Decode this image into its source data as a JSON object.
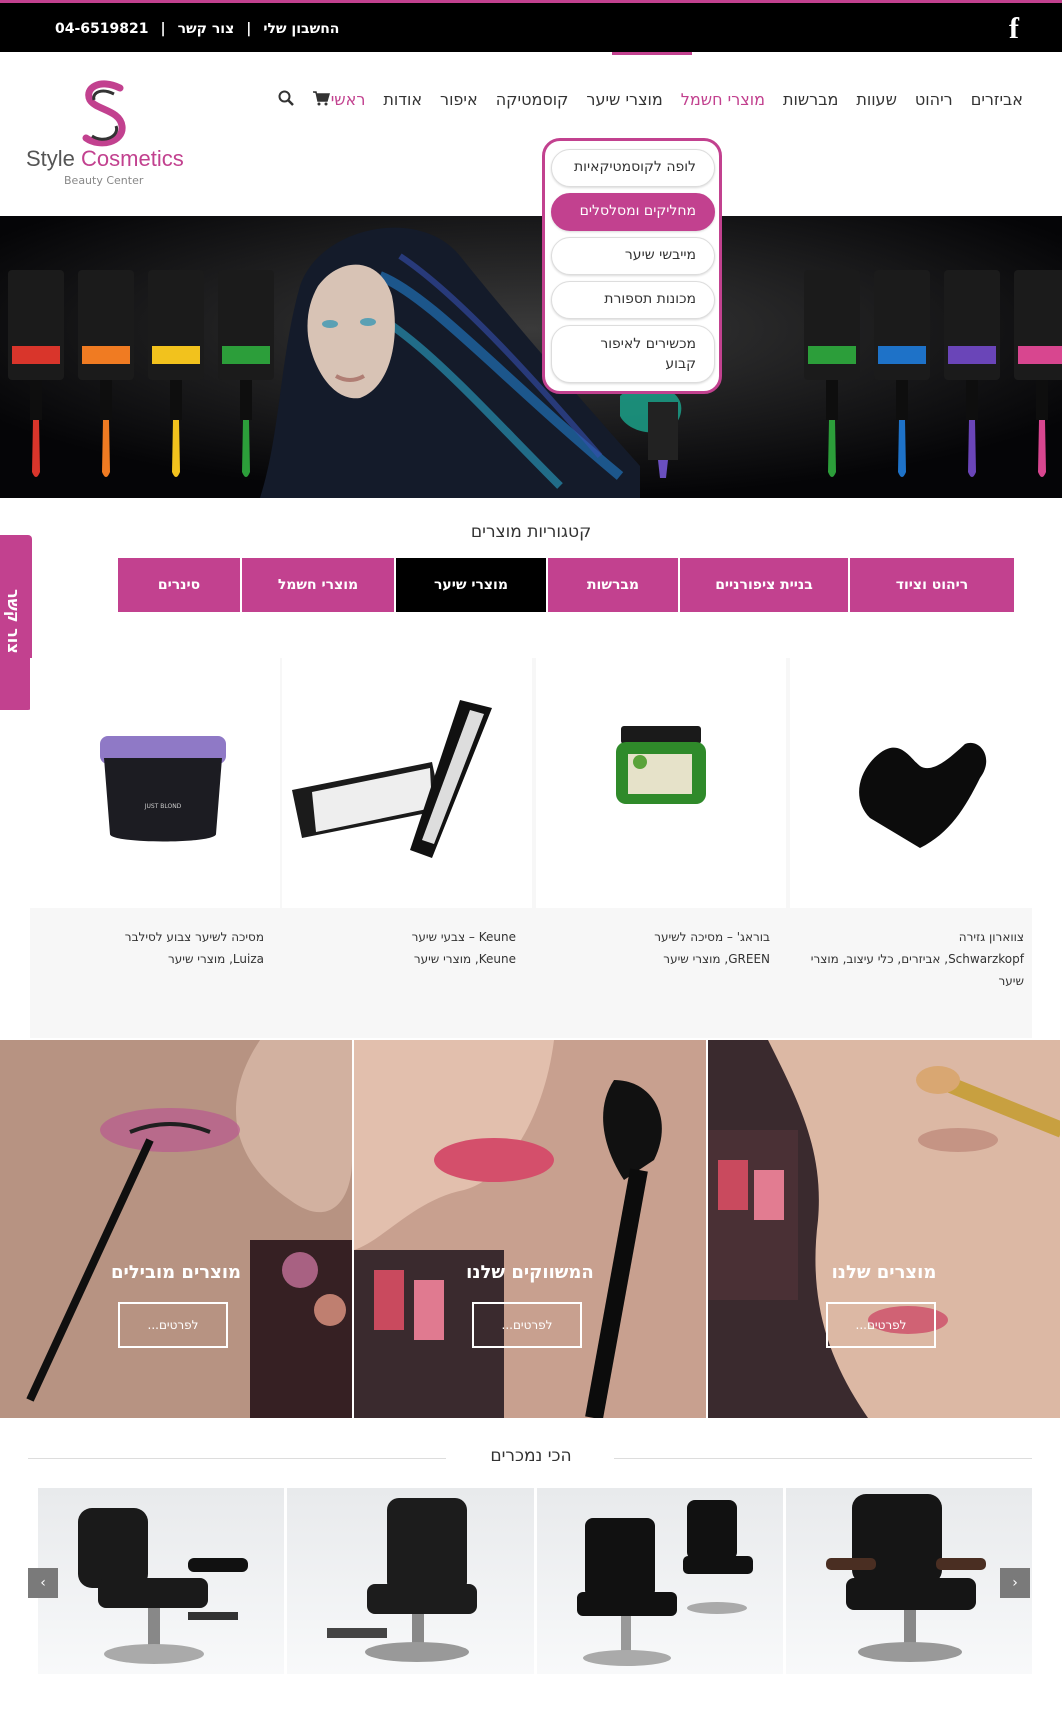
{
  "topbar": {
    "phone": "04-6519821",
    "sep1": "|",
    "contact": "צור קשר",
    "sep2": "|",
    "account": "החשבון שלי",
    "facebook_icon": "facebook-icon"
  },
  "logo": {
    "brand_part1": "Style",
    "brand_part2": "Cosmetics",
    "subtitle": "Beauty Center"
  },
  "nav": {
    "items": [
      "ראשי",
      "אודות",
      "איפור",
      "קוסמטיקה",
      "מוצרי שיער",
      "מוצרי חשמל",
      "מברשות",
      "שעוות",
      "ריהוט",
      "אביזרים"
    ],
    "active_index": 0,
    "hover_index": 5
  },
  "dropdown": {
    "items": [
      "לופה לקוסמטיקאיות",
      "מחליקים ומסלסלים",
      "מייבשי שיער",
      "מכונות תספורת",
      "מכשירים לאיפור קבוע"
    ],
    "selected_index": 1
  },
  "sidetab": {
    "label": "צור קשר"
  },
  "categories": {
    "title": "קטגוריות מוצרים",
    "tabs": [
      "ריהוט וציוד",
      "בניית ציפורניים",
      "מברשות",
      "מוצרי שיער",
      "מוצרי חשמל",
      "סינרים"
    ],
    "active_index": 3
  },
  "products": [
    {
      "title": "צווארון גזירה",
      "meta": "Schwarzkopf, אביזרים, כלי עיצוב, מוצרי שיער"
    },
    {
      "title": "בוראג' – מסיכה לשיער",
      "meta": "GREEN, מוצרי שיער"
    },
    {
      "title": "Keune – צבעי שיער",
      "meta": "Keune, מוצרי שיער"
    },
    {
      "title": "מסיכה לשיער צבוע לסילבר",
      "meta": "Luiza, מוצרי שיער"
    }
  ],
  "promos": [
    {
      "title": "מוצרים מובילים",
      "button": "לפרטים..."
    },
    {
      "title": "המשווקים שלנו",
      "button": "לפרטים..."
    },
    {
      "title": "מוצרים שלנו",
      "button": "לפרטים..."
    }
  ],
  "bestsellers": {
    "title": "הכי נמכרים",
    "prev_icon": "chevron-left-icon",
    "next_icon": "chevron-right-icon",
    "prev": "‹",
    "next": "›"
  },
  "colors": {
    "accent": "#c2418f",
    "topbar": "#000000",
    "active_tab": "#000000"
  }
}
